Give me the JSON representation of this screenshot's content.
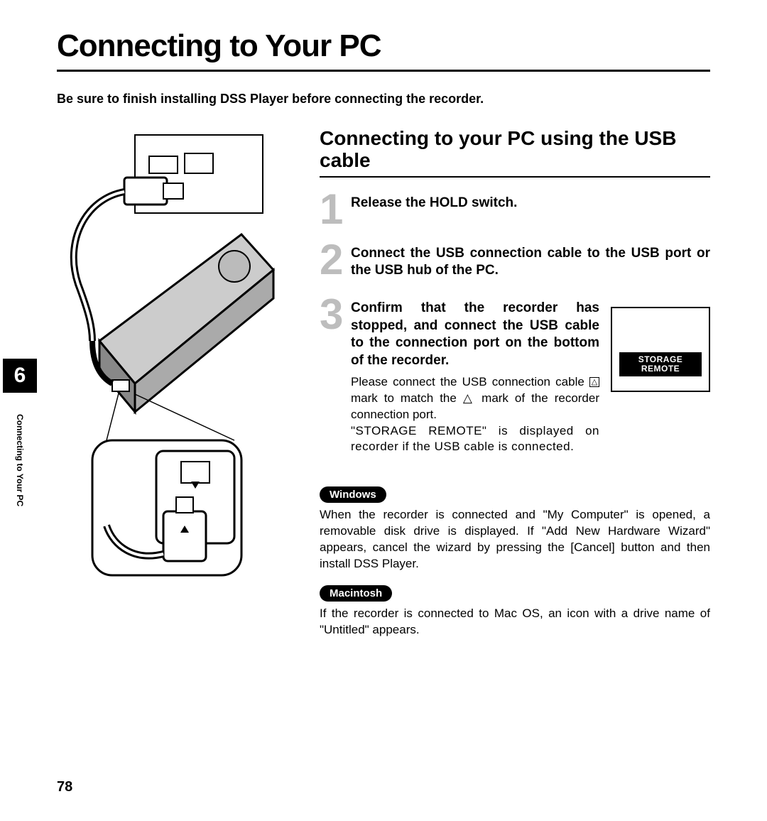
{
  "title": "Connecting to Your PC",
  "intro": "Be sure to finish installing DSS Player before connecting the recorder.",
  "chapter_number": "6",
  "side_label": "Connecting to Your PC",
  "page_number": "78",
  "section_title": "Connecting to your PC using the USB cable",
  "steps": [
    {
      "num": "1",
      "title_pre": "Release the ",
      "title_bold": "HOLD",
      "title_post": " switch."
    },
    {
      "num": "2",
      "title": "Connect the USB connection cable to the USB port or the USB hub of the PC."
    },
    {
      "num": "3",
      "title": "Confirm that the recorder has stopped, and connect the USB cable to the connection port on the bottom of the recorder.",
      "body_pre": "Please connect the USB connection cable ",
      "body_mid1": " mark to match the ",
      "body_mid2": " mark of the recorder connection port.",
      "body_post": "\"STORAGE REMOTE\" is displayed on recorder if the USB cable is connected."
    }
  ],
  "display_line1": "STORAGE",
  "display_line2": "REMOTE",
  "os": [
    {
      "label": "Windows",
      "text": "When the recorder is connected and \"My Computer\" is opened, a removable disk drive is displayed. If \"Add New Hardware Wizard\" appears, cancel the wizard by pressing the [Cancel] button and then install DSS Player."
    },
    {
      "label": "Macintosh",
      "text": "If the recorder is connected to Mac OS, an icon with a drive name of \"Untitled\" appears."
    }
  ]
}
